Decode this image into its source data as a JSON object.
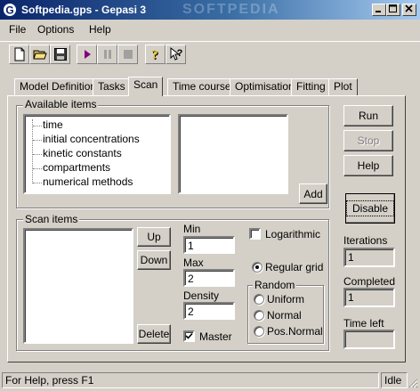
{
  "window": {
    "title": "Softpedia.gps - Gepasi 3",
    "watermark": "SOFTPEDIA"
  },
  "menu": [
    "File",
    "Options",
    "Help"
  ],
  "toolbar": {
    "buttons": [
      "new-file",
      "open-folder",
      "save",
      "play",
      "pause",
      "stop",
      "help",
      "context-help"
    ]
  },
  "tabs": [
    {
      "label": "Model Definition"
    },
    {
      "label": "Tasks"
    },
    {
      "label": "Scan",
      "active": true
    },
    {
      "label": "Time course"
    },
    {
      "label": "Optimisation"
    },
    {
      "label": "Fitting"
    },
    {
      "label": "Plot"
    }
  ],
  "available_items": {
    "label": "Available items",
    "tree": [
      "time",
      "initial concentrations",
      "kinetic constants",
      "compartments",
      "numerical methods"
    ],
    "add_button": "Add"
  },
  "scan_items": {
    "label": "Scan items",
    "up_button": "Up",
    "down_button": "Down",
    "delete_button": "Delete",
    "min_label": "Min",
    "min_value": "1",
    "max_label": "Max",
    "max_value": "2",
    "density_label": "Density",
    "density_value": "2",
    "master_label": "Master",
    "master_checked": true,
    "logarithmic_label": "Logarithmic",
    "logarithmic_checked": false,
    "regular_grid_label": "Regular grid",
    "regular_grid_selected": true,
    "random_group_label": "Random",
    "random_options": [
      "Uniform",
      "Normal",
      "Pos.Normal"
    ]
  },
  "side": {
    "run_button": "Run",
    "stop_button": "Stop",
    "help_button": "Help",
    "disable_button": "Disable",
    "iterations_label": "Iterations",
    "iterations_value": "1",
    "completed_label": "Completed",
    "completed_value": "1",
    "time_left_label": "Time left",
    "time_left_value": ""
  },
  "status": {
    "message": "For Help, press F1",
    "state": "Idle"
  },
  "colors": {
    "titlebar_start": "#0a246a",
    "titlebar_end": "#a6caf0",
    "face": "#d4d0c8",
    "play": "#800080"
  }
}
